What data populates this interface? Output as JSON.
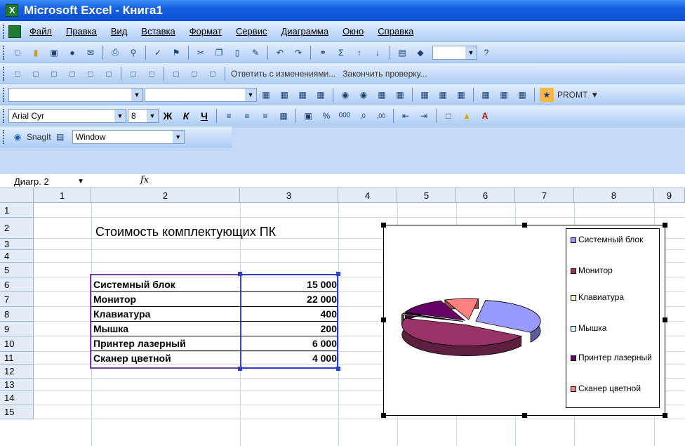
{
  "window": {
    "title": "Microsoft Excel - Книга1"
  },
  "menu": [
    "Файл",
    "Правка",
    "Вид",
    "Вставка",
    "Формат",
    "Сервис",
    "Диаграмма",
    "Окно",
    "Справка"
  ],
  "review_bar": {
    "reply_label": "Ответить с изменениями...",
    "finish_label": "Закончить проверку..."
  },
  "promt": {
    "label": "PROMT"
  },
  "font": {
    "name": "Arial Cyr",
    "size": "8"
  },
  "snagit": {
    "label": "SnagIt",
    "mode": "Window"
  },
  "formula": {
    "namebox": "Диагр. 2",
    "fx": "fx"
  },
  "columns": [
    "1",
    "2",
    "3",
    "4",
    "5",
    "6",
    "7",
    "8",
    "9"
  ],
  "rows": [
    "1",
    "2",
    "3",
    "4",
    "5",
    "6",
    "7",
    "8",
    "9",
    "10",
    "11",
    "12",
    "13",
    "14",
    "15"
  ],
  "sheet": {
    "title": "Стоимость комплектующих ПК",
    "items": [
      {
        "name": "Системный блок",
        "value": "15 000"
      },
      {
        "name": "Монитор",
        "value": "22 000"
      },
      {
        "name": "Клавиатура",
        "value": "400"
      },
      {
        "name": "Мышка",
        "value": "200"
      },
      {
        "name": "Принтер лазерный",
        "value": "6 000"
      },
      {
        "name": "Сканер цветной",
        "value": "4 000"
      }
    ]
  },
  "chart_data": {
    "type": "pie",
    "categories": [
      "Системный блок",
      "Монитор",
      "Клавиатура",
      "Мышка",
      "Принтер лазерный",
      "Сканер цветной"
    ],
    "values": [
      15000,
      22000,
      400,
      200,
      6000,
      4000
    ],
    "colors": [
      "#9999ff",
      "#993366",
      "#ffffcc",
      "#ccffff",
      "#660066",
      "#ff8080"
    ],
    "legend_position": "right",
    "style": "3d-exploded"
  }
}
